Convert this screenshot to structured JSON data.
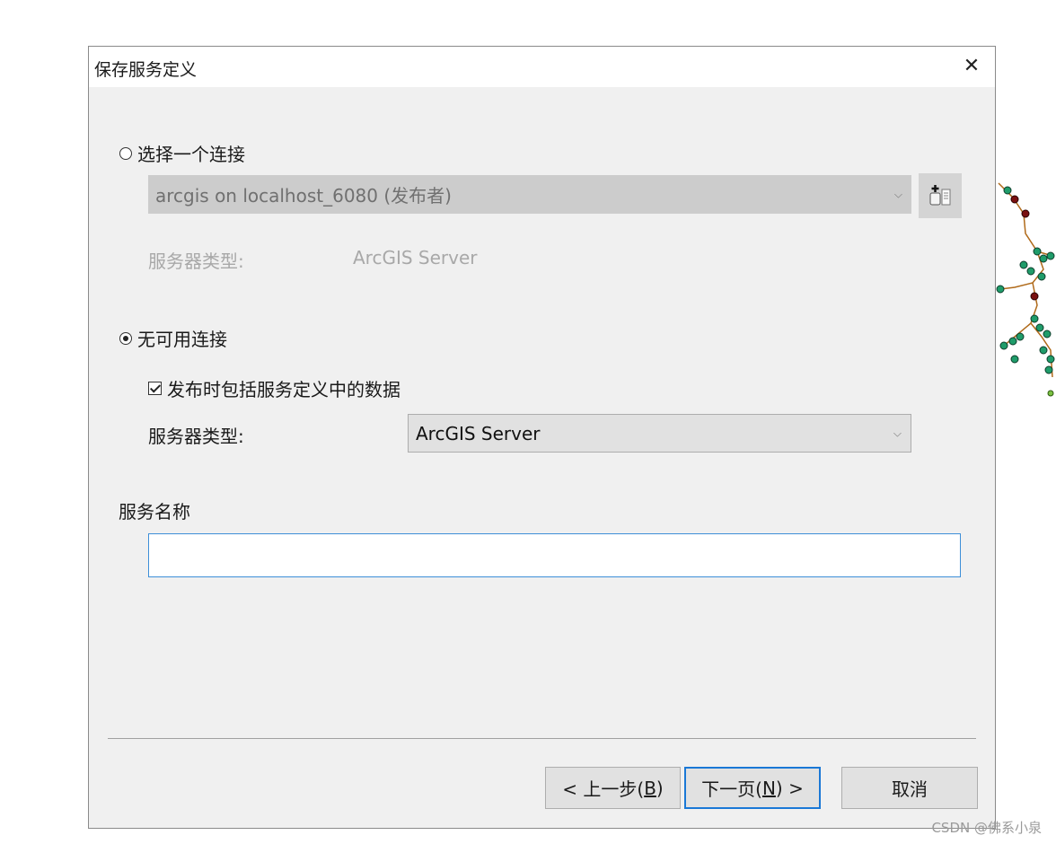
{
  "dialog": {
    "title": "保存服务定义",
    "close_glyph": "✕"
  },
  "select_connection": {
    "radio_label": "选择一个连接",
    "checked": false,
    "combo_value": "arcgis on localhost_6080 (发布者)",
    "server_type_label": "服务器类型:",
    "server_type_value": "ArcGIS Server",
    "add_connection_icon": "add-server-connection-icon"
  },
  "no_connection": {
    "radio_label": "无可用连接",
    "checked": true,
    "checkbox_label": "发布时包括服务定义中的数据",
    "checkbox_checked": true,
    "server_type_label": "服务器类型:",
    "server_type_value": "ArcGIS Server"
  },
  "service_name": {
    "label": "服务名称",
    "value": ""
  },
  "buttons": {
    "back_prefix": "< 上一步(",
    "back_key": "B",
    "back_suffix": ")",
    "next_prefix": "下一页(",
    "next_key": "N",
    "next_suffix": ") >",
    "cancel": "取消"
  },
  "watermark": "CSDN @佛系小泉",
  "colors": {
    "dialog_bg": "#f0f0f0",
    "accent_border": "#1a78d6",
    "input_border": "#3d8fd8"
  }
}
